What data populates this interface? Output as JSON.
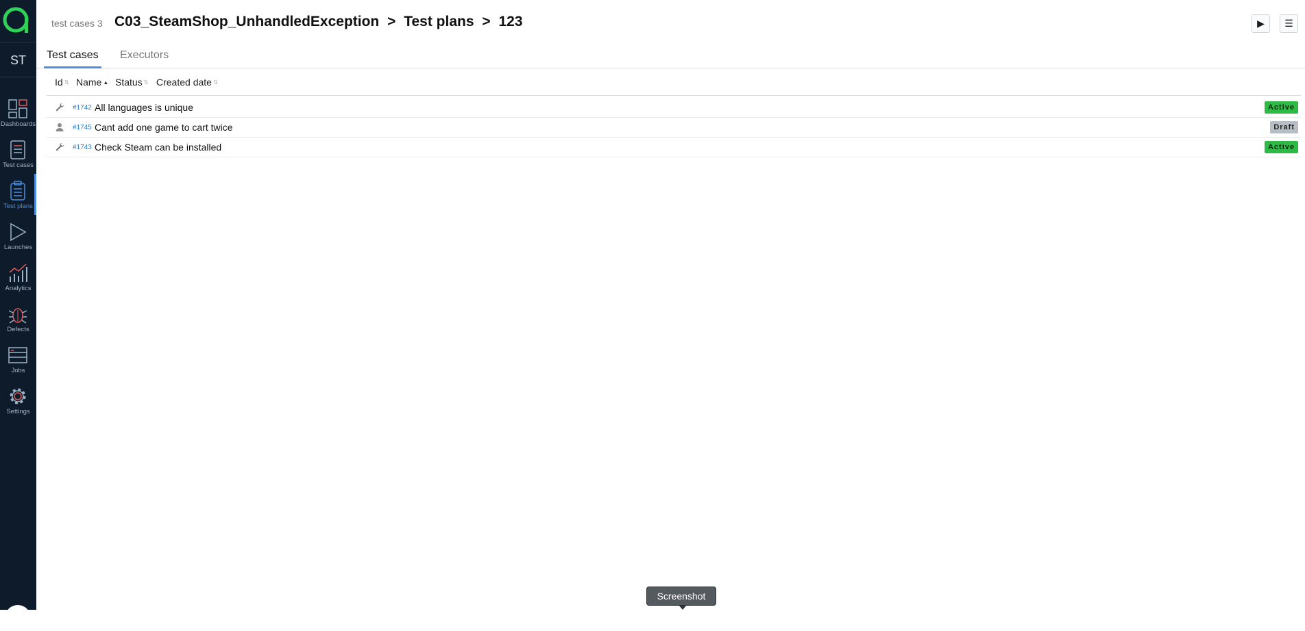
{
  "workspace": {
    "initials": "ST"
  },
  "sidebar": {
    "items": [
      {
        "label": "Dashboards",
        "icon": "dashboard-icon",
        "active": false
      },
      {
        "label": "Test cases",
        "icon": "test-cases-icon",
        "active": false
      },
      {
        "label": "Test plans",
        "icon": "test-plans-icon",
        "active": true
      },
      {
        "label": "Launches",
        "icon": "launch-icon",
        "active": false
      },
      {
        "label": "Analytics",
        "icon": "analytics-icon",
        "active": false
      },
      {
        "label": "Defects",
        "icon": "bug-icon",
        "active": false
      },
      {
        "label": "Jobs",
        "icon": "jobs-icon",
        "active": false
      },
      {
        "label": "Settings",
        "icon": "gear-icon",
        "active": false
      }
    ]
  },
  "header": {
    "subtitle": "test cases 3",
    "breadcrumb": [
      "C03_SteamShop_UnhandledException",
      "Test plans",
      "123"
    ],
    "separator": ">",
    "run_icon": "play-icon",
    "menu_icon": "menu-icon"
  },
  "tabs": [
    {
      "label": "Test cases",
      "active": true
    },
    {
      "label": "Executors",
      "active": false
    }
  ],
  "table": {
    "columns": [
      "Id",
      "Name",
      "Status",
      "Created date"
    ],
    "rows": [
      {
        "type_icon": "wrench-icon",
        "id": "#1742",
        "name": "All languages is unique",
        "status": "Active"
      },
      {
        "type_icon": "person-icon",
        "id": "#1745",
        "name": "Cant add one game to cart twice",
        "status": "Draft"
      },
      {
        "type_icon": "wrench-icon",
        "id": "#1743",
        "name": "Check Steam can be installed",
        "status": "Active"
      }
    ]
  },
  "tooltip": {
    "text": "Screenshot"
  },
  "colors": {
    "sidebar_bg": "#0d1b2a",
    "accent": "#4a90e2",
    "active_badge": "#2fba45",
    "draft_badge": "#b7bec6",
    "logo": "#2fd158"
  }
}
